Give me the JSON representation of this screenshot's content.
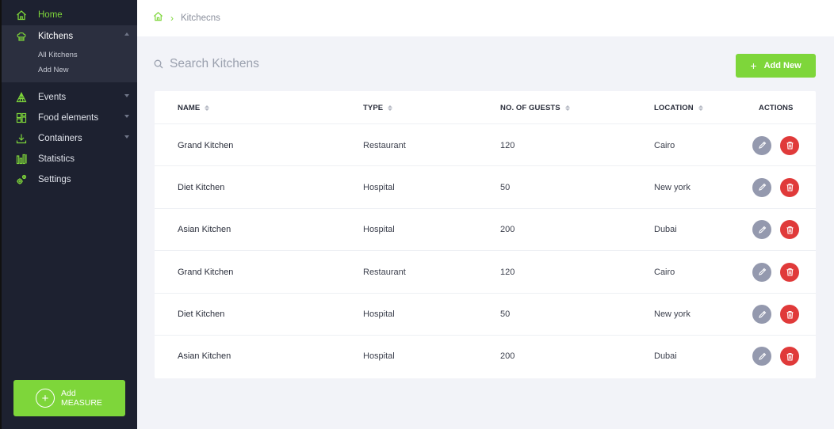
{
  "sidebar": {
    "items": [
      {
        "label": "Home",
        "icon": "home-icon"
      },
      {
        "label": "Kitchens",
        "icon": "chef-hat-icon"
      },
      {
        "label": "Events",
        "icon": "tent-icon"
      },
      {
        "label": "Food elements",
        "icon": "grid-icon"
      },
      {
        "label": "Containers",
        "icon": "download-icon"
      },
      {
        "label": "Statistics",
        "icon": "bar-chart-icon"
      },
      {
        "label": "Settings",
        "icon": "gears-icon"
      }
    ],
    "kitchens_sub": [
      "All Kitchens",
      "Add New"
    ],
    "add_measure": {
      "line1": "Add",
      "line2": "MEASURE"
    }
  },
  "breadcrumb": {
    "current": "Kitchecns",
    "separator": "›"
  },
  "search": {
    "placeholder": "Search Kitchens"
  },
  "add_new_label": "Add New",
  "table": {
    "headers": {
      "name": "NAME",
      "type": "TYPE",
      "guests": "NO. OF GUESTS",
      "location": "LOCATION",
      "actions": "ACTIONS"
    },
    "rows": [
      {
        "name": "Grand Kitchen",
        "type": "Restaurant",
        "guests": "120",
        "location": "Cairo"
      },
      {
        "name": "Diet Kitchen",
        "type": "Hospital",
        "guests": "50",
        "location": "New york"
      },
      {
        "name": "Asian Kitchen",
        "type": "Hospital",
        "guests": "200",
        "location": "Dubai"
      },
      {
        "name": "Grand Kitchen",
        "type": "Restaurant",
        "guests": "120",
        "location": "Cairo"
      },
      {
        "name": "Diet Kitchen",
        "type": "Hospital",
        "guests": "50",
        "location": "New york"
      },
      {
        "name": "Asian Kitchen",
        "type": "Hospital",
        "guests": "200",
        "location": "Dubai"
      }
    ]
  },
  "colors": {
    "accent": "#7ed63a",
    "sidebar_bg": "#1d2130",
    "delete": "#e03a3a",
    "edit": "#9499ae"
  }
}
